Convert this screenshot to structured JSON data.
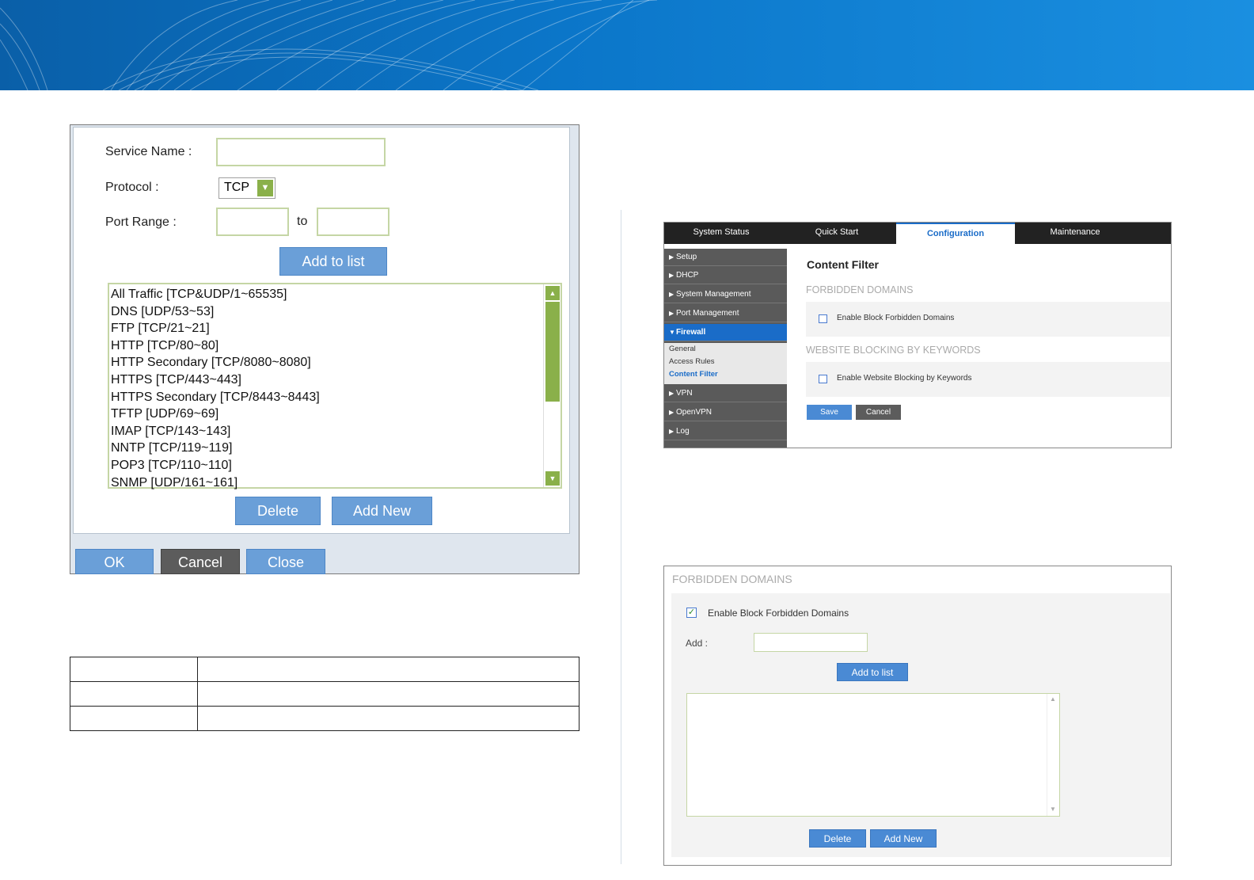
{
  "service_dialog": {
    "service_name_label": "Service Name :",
    "service_name_value": "",
    "protocol_label": "Protocol :",
    "protocol_value": "TCP",
    "port_range_label": "Port Range :",
    "port_from": "",
    "port_to_label": "to",
    "port_to": "",
    "add_to_list": "Add to list",
    "services": [
      "All Traffic [TCP&UDP/1~65535]",
      "DNS [UDP/53~53]",
      "FTP [TCP/21~21]",
      "HTTP [TCP/80~80]",
      "HTTP Secondary [TCP/8080~8080]",
      "HTTPS [TCP/443~443]",
      "HTTPS Secondary [TCP/8443~8443]",
      "TFTP [UDP/69~69]",
      "IMAP [TCP/143~143]",
      "NNTP [TCP/119~119]",
      "POP3 [TCP/110~110]",
      "SNMP [UDP/161~161]"
    ],
    "delete": "Delete",
    "add_new": "Add New",
    "ok": "OK",
    "cancel": "Cancel",
    "close": "Close"
  },
  "content_filter": {
    "tabs": [
      "System Status",
      "Quick Start",
      "Configuration",
      "Maintenance"
    ],
    "active_tab": "Configuration",
    "nav": {
      "setup": "Setup",
      "dhcp": "DHCP",
      "system_management": "System Management",
      "port_management": "Port Management",
      "firewall": "Firewall",
      "vpn": "VPN",
      "openvpn": "OpenVPN",
      "log": "Log"
    },
    "firewall_sub": {
      "general": "General",
      "access_rules": "Access Rules",
      "content_filter": "Content Filter"
    },
    "title": "Content Filter",
    "forbidden_section": "FORBIDDEN DOMAINS",
    "forbidden_checkbox": "Enable Block Forbidden Domains",
    "keywords_section": "WEBSITE BLOCKING BY KEYWORDS",
    "keywords_checkbox": "Enable Website Blocking by Keywords",
    "save": "Save",
    "cancel": "Cancel"
  },
  "forbidden_domains": {
    "title": "FORBIDDEN DOMAINS",
    "checkbox_label": "Enable Block Forbidden Domains",
    "checkbox_checked": true,
    "add_label": "Add :",
    "add_value": "",
    "add_to_list": "Add to list",
    "delete": "Delete",
    "add_new": "Add New"
  },
  "colors": {
    "banner": "#0b76c9",
    "button_blue": "#6a9fd8",
    "button_grey": "#5c5c5c",
    "field_border": "#c5d6a5",
    "active_nav": "#1a6cc8"
  }
}
